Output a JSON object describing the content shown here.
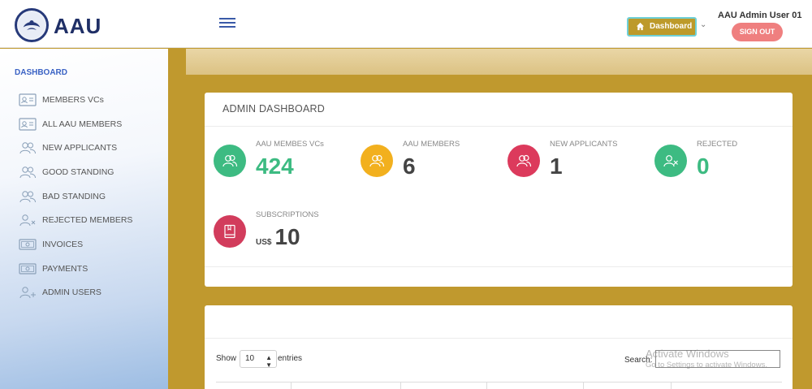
{
  "brand": {
    "name": "AAU"
  },
  "header": {
    "dashboard_button": "Dashboard",
    "user_name": "AAU Admin User 01",
    "signout_label": "SIGN OUT"
  },
  "sidebar": {
    "heading": "DASHBOARD",
    "items": [
      {
        "label": "MEMBERS VCs",
        "icon": "id-card-icon"
      },
      {
        "label": "ALL AAU MEMBERS",
        "icon": "id-card-icon"
      },
      {
        "label": "NEW APPLICANTS",
        "icon": "users-icon"
      },
      {
        "label": "GOOD STANDING",
        "icon": "users-icon"
      },
      {
        "label": "BAD STANDING",
        "icon": "users-icon"
      },
      {
        "label": "REJECTED MEMBERS",
        "icon": "user-x-icon"
      },
      {
        "label": "INVOICES",
        "icon": "money-icon"
      },
      {
        "label": "PAYMENTS",
        "icon": "money-icon"
      },
      {
        "label": "ADMIN USERS",
        "icon": "user-plus-icon"
      }
    ]
  },
  "dashboard": {
    "title": "ADMIN DASHBOARD",
    "stats": [
      {
        "label": "AAU MEMBES VCs",
        "value": "424",
        "color": "#3dbb82",
        "value_color": "#3dbb82"
      },
      {
        "label": "AAU MEMBERS",
        "value": "6",
        "color": "#f2b01e",
        "value_color": "#444444"
      },
      {
        "label": "NEW APPLICANTS",
        "value": "1",
        "color": "#dc3a5c",
        "value_color": "#444444"
      },
      {
        "label": "REJECTED",
        "value": "0",
        "color": "#3dbb82",
        "value_color": "#3dbb82"
      },
      {
        "label": "SUBSCRIPTIONS",
        "value": "10",
        "currency": "US$",
        "color": "#d23c5c",
        "value_color": "#444444"
      }
    ]
  },
  "table_controls": {
    "show_label": "Show",
    "entries_value": "10",
    "entries_label": "entries",
    "search_label": "Search:",
    "search_value": ""
  },
  "watermark": {
    "line1": "Activate Windows",
    "line2": "Go to Settings to activate Windows."
  },
  "colors": {
    "background": "#c0992e",
    "brand_blue": "#1f2f66",
    "sidebar_heading": "#3a62c4",
    "dashboard_button": "#bd9a2a",
    "signout": "#ef7f7f"
  }
}
